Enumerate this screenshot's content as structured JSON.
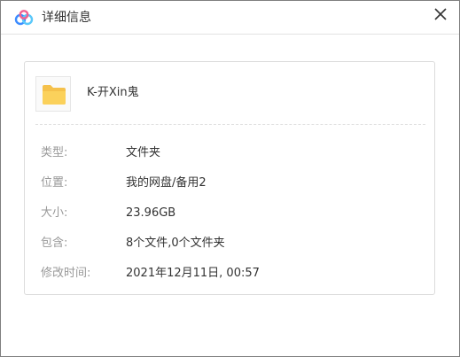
{
  "window": {
    "title": "详细信息",
    "logo_icon": "baidu-netdisk-logo-icon",
    "close_icon": "close-icon"
  },
  "file": {
    "icon": "folder-icon",
    "icon_color": "#f5c14b",
    "name": "K-开Xin鬼"
  },
  "details": [
    {
      "label": "类型:",
      "value": "文件夹"
    },
    {
      "label": "位置:",
      "value": "我的网盘/备用2"
    },
    {
      "label": "大小:",
      "value": "23.96GB"
    },
    {
      "label": "包含:",
      "value": "8个文件,0个文件夹"
    },
    {
      "label": "修改时间:",
      "value": "2021年12月11日, 00:57"
    }
  ]
}
